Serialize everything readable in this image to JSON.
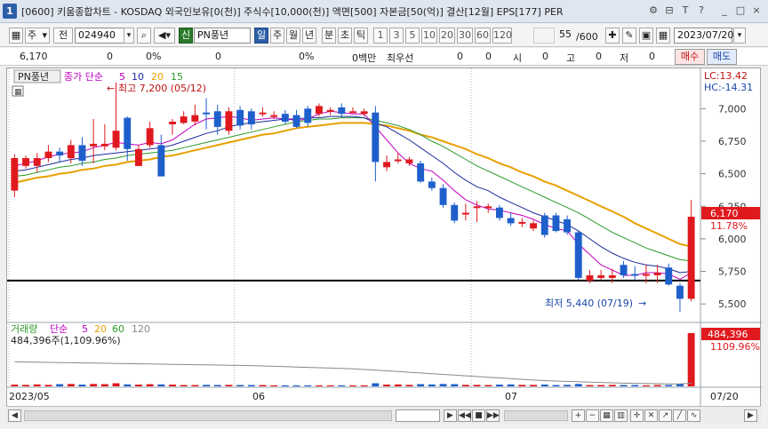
{
  "window": {
    "number": "1",
    "title": "[0600] 키움종합차트 - KOSDAQ 외국인보유[0(천)] 주식수[10,000(천)] 액면[500] 자본금[50(억)] 결산[12월] EPS[177] PER",
    "controls": [
      "⚙",
      "⊟",
      "T",
      "?",
      "_",
      "□",
      "×"
    ]
  },
  "toolbar": {
    "type_label": "주",
    "prev_label": "전",
    "code_value": "024940",
    "signal_label": "신",
    "stock_name": "PN풍년",
    "periods": [
      "일",
      "주",
      "월",
      "년",
      "분",
      "초",
      "틱"
    ],
    "active_period": "일",
    "intervals": [
      "1",
      "3",
      "5",
      "10",
      "20",
      "30",
      "60",
      "120"
    ],
    "count_value": "55",
    "count_total": "/600",
    "date_value": "2023/07/20"
  },
  "inforow": {
    "price": "6,170",
    "change": "0",
    "change_pct": "0%",
    "volume": "0",
    "volume_pct": "0%",
    "amount": "0백만",
    "best_bid_label": "최우선",
    "best_bid": "0",
    "val2": "0",
    "open_label": "시",
    "open": "0",
    "high_label": "고",
    "high": "0",
    "low_label": "저",
    "low": "0",
    "buy_label": "매수",
    "sell_label": "매도"
  },
  "price_panel": {
    "stock_tag": "PN풍년",
    "ma_label": "종가 단순",
    "ma_periods": [
      {
        "label": "5",
        "color": "#c000c0"
      },
      {
        "label": "10",
        "color": "#1a2a9a"
      },
      {
        "label": "20",
        "color": "#e8a000"
      },
      {
        "label": "15",
        "color": "#2a9a2a"
      }
    ],
    "lc_label": "LC:13.42",
    "hc_label": "HC:-14.31",
    "max_note": "최고 7,200 (05/12)",
    "min_note": "최저 5,440 (07/19)",
    "current_price_tag": "6,170",
    "current_pct_tag": "11.78%",
    "y_ticks": [
      "7,000",
      "6,750",
      "6,500",
      "6,250",
      "6,000",
      "5,750",
      "5,500"
    ]
  },
  "volume_panel": {
    "label": "거래량",
    "ma_label": "단순",
    "ma_periods": [
      {
        "label": "5",
        "color": "#c000c0"
      },
      {
        "label": "20",
        "color": "#e8a000"
      },
      {
        "label": "60",
        "color": "#2a9a2a"
      },
      {
        "label": "120",
        "color": "#888888"
      }
    ],
    "current_text": "484,396주(1,109.96%)",
    "tag_value": "484,396",
    "tag_pct": "1109.96%"
  },
  "x_axis": {
    "labels": [
      "2023/05",
      "06",
      "07"
    ],
    "right_label": "07/20"
  },
  "colors": {
    "up": "#e0191e",
    "down": "#1f5fcc",
    "accent": "#2d5fa8"
  },
  "chart_data": {
    "type": "candlestick",
    "ylim": [
      5440,
      7200
    ],
    "horizontal_line": 5680,
    "candles": [
      {
        "o": 6370,
        "c": 6620,
        "h": 6650,
        "l": 6320,
        "up": true
      },
      {
        "o": 6560,
        "c": 6620,
        "h": 6640,
        "l": 6540,
        "up": true
      },
      {
        "o": 6560,
        "c": 6620,
        "h": 6660,
        "l": 6510,
        "up": true
      },
      {
        "o": 6620,
        "c": 6670,
        "h": 6720,
        "l": 6590,
        "up": true
      },
      {
        "o": 6670,
        "c": 6640,
        "h": 6700,
        "l": 6590,
        "up": false
      },
      {
        "o": 6620,
        "c": 6720,
        "h": 6760,
        "l": 6580,
        "up": true
      },
      {
        "o": 6720,
        "c": 6600,
        "h": 6780,
        "l": 6560,
        "up": false
      },
      {
        "o": 6710,
        "c": 6730,
        "h": 6920,
        "l": 6580,
        "up": true
      },
      {
        "o": 6710,
        "c": 6730,
        "h": 6880,
        "l": 6680,
        "up": true
      },
      {
        "o": 6700,
        "c": 6830,
        "h": 7200,
        "l": 6680,
        "up": true
      },
      {
        "o": 6930,
        "c": 6690,
        "h": 6940,
        "l": 6600,
        "up": false
      },
      {
        "o": 6560,
        "c": 6690,
        "h": 6720,
        "l": 6560,
        "up": true
      },
      {
        "o": 6720,
        "c": 6850,
        "h": 6900,
        "l": 6700,
        "up": true
      },
      {
        "o": 6720,
        "c": 6480,
        "h": 6800,
        "l": 6480,
        "up": false
      },
      {
        "o": 6880,
        "c": 6900,
        "h": 6920,
        "l": 6800,
        "up": true
      },
      {
        "o": 6890,
        "c": 6940,
        "h": 6980,
        "l": 6880,
        "up": true
      },
      {
        "o": 6900,
        "c": 6950,
        "h": 7030,
        "l": 6870,
        "up": true
      },
      {
        "o": 6970,
        "c": 6960,
        "h": 7080,
        "l": 6840,
        "up": false
      },
      {
        "o": 6980,
        "c": 6860,
        "h": 7030,
        "l": 6800,
        "up": false
      },
      {
        "o": 6830,
        "c": 6980,
        "h": 7010,
        "l": 6800,
        "up": true
      },
      {
        "o": 6990,
        "c": 6870,
        "h": 7020,
        "l": 6840,
        "up": false
      },
      {
        "o": 6980,
        "c": 6880,
        "h": 7000,
        "l": 6840,
        "up": false
      },
      {
        "o": 6960,
        "c": 6970,
        "h": 7010,
        "l": 6940,
        "up": true
      },
      {
        "o": 6950,
        "c": 6940,
        "h": 6980,
        "l": 6920,
        "up": true
      },
      {
        "o": 6960,
        "c": 6900,
        "h": 6990,
        "l": 6880,
        "up": false
      },
      {
        "o": 6950,
        "c": 6860,
        "h": 6990,
        "l": 6850,
        "up": false
      },
      {
        "o": 7000,
        "c": 6890,
        "h": 7020,
        "l": 6860,
        "up": false
      },
      {
        "o": 6960,
        "c": 7020,
        "h": 7040,
        "l": 6940,
        "up": true
      },
      {
        "o": 6980,
        "c": 6990,
        "h": 7010,
        "l": 6950,
        "up": true
      },
      {
        "o": 7010,
        "c": 6960,
        "h": 7040,
        "l": 6930,
        "up": false
      },
      {
        "o": 6980,
        "c": 6980,
        "h": 7010,
        "l": 6970,
        "up": true
      },
      {
        "o": 6980,
        "c": 6960,
        "h": 7000,
        "l": 6940,
        "up": true
      },
      {
        "o": 6970,
        "c": 6590,
        "h": 7020,
        "l": 6440,
        "up": false
      },
      {
        "o": 6590,
        "c": 6550,
        "h": 6640,
        "l": 6520,
        "up": true
      },
      {
        "o": 6600,
        "c": 6610,
        "h": 6660,
        "l": 6580,
        "up": true
      },
      {
        "o": 6610,
        "c": 6580,
        "h": 6630,
        "l": 6560,
        "up": true
      },
      {
        "o": 6580,
        "c": 6440,
        "h": 6600,
        "l": 6430,
        "up": false
      },
      {
        "o": 6440,
        "c": 6390,
        "h": 6470,
        "l": 6370,
        "up": false
      },
      {
        "o": 6390,
        "c": 6260,
        "h": 6420,
        "l": 6240,
        "up": false
      },
      {
        "o": 6260,
        "c": 6140,
        "h": 6280,
        "l": 6120,
        "up": false
      },
      {
        "o": 6190,
        "c": 6200,
        "h": 6270,
        "l": 6140,
        "up": true
      },
      {
        "o": 6240,
        "c": 6250,
        "h": 6290,
        "l": 6130,
        "up": true
      },
      {
        "o": 6250,
        "c": 6240,
        "h": 6270,
        "l": 6200,
        "up": true
      },
      {
        "o": 6240,
        "c": 6160,
        "h": 6260,
        "l": 6140,
        "up": false
      },
      {
        "o": 6160,
        "c": 6120,
        "h": 6200,
        "l": 6100,
        "up": false
      },
      {
        "o": 6130,
        "c": 6120,
        "h": 6160,
        "l": 6090,
        "up": true
      },
      {
        "o": 6120,
        "c": 6080,
        "h": 6140,
        "l": 6060,
        "up": true
      },
      {
        "o": 6180,
        "c": 6030,
        "h": 6200,
        "l": 6010,
        "up": false
      },
      {
        "o": 6180,
        "c": 6060,
        "h": 6200,
        "l": 6050,
        "up": false
      },
      {
        "o": 6150,
        "c": 6050,
        "h": 6180,
        "l": 6030,
        "up": false
      },
      {
        "o": 6050,
        "c": 5700,
        "h": 6060,
        "l": 5680,
        "up": false
      },
      {
        "o": 5680,
        "c": 5720,
        "h": 5760,
        "l": 5660,
        "up": true
      },
      {
        "o": 5700,
        "c": 5720,
        "h": 5760,
        "l": 5680,
        "up": true
      },
      {
        "o": 5700,
        "c": 5720,
        "h": 5770,
        "l": 5660,
        "up": true
      },
      {
        "o": 5800,
        "c": 5720,
        "h": 5830,
        "l": 5700,
        "up": false
      },
      {
        "o": 5730,
        "c": 5730,
        "h": 5790,
        "l": 5680,
        "up": false
      },
      {
        "o": 5730,
        "c": 5730,
        "h": 5800,
        "l": 5660,
        "up": true
      },
      {
        "o": 5720,
        "c": 5740,
        "h": 5800,
        "l": 5660,
        "up": true
      },
      {
        "o": 5780,
        "c": 5650,
        "h": 5810,
        "l": 5640,
        "up": false
      },
      {
        "o": 5640,
        "c": 5540,
        "h": 5660,
        "l": 5440,
        "up": false
      },
      {
        "o": 5540,
        "c": 6170,
        "h": 6300,
        "l": 5520,
        "up": true
      }
    ],
    "ma5": [
      6560,
      6580,
      6600,
      6630,
      6650,
      6660,
      6670,
      6700,
      6720,
      6740,
      6730,
      6720,
      6740,
      6730,
      6760,
      6820,
      6880,
      6920,
      6930,
      6940,
      6930,
      6910,
      6920,
      6930,
      6920,
      6910,
      6920,
      6960,
      6980,
      6970,
      6960,
      6960,
      6860,
      6760,
      6660,
      6580,
      6540,
      6520,
      6450,
      6370,
      6300,
      6260,
      6230,
      6220,
      6200,
      6180,
      6150,
      6110,
      6080,
      6060,
      5960,
      5880,
      5800,
      5760,
      5720,
      5720,
      5740,
      5740,
      5730,
      5690,
      5740
    ],
    "ma10": [
      6520,
      6530,
      6550,
      6570,
      6590,
      6610,
      6620,
      6640,
      6650,
      6660,
      6670,
      6680,
      6690,
      6700,
      6720,
      6750,
      6780,
      6810,
      6830,
      6860,
      6880,
      6890,
      6900,
      6910,
      6920,
      6920,
      6930,
      6930,
      6940,
      6940,
      6940,
      6930,
      6890,
      6860,
      6810,
      6760,
      6700,
      6640,
      6580,
      6510,
      6450,
      6400,
      6370,
      6320,
      6280,
      6240,
      6200,
      6170,
      6140,
      6110,
      6060,
      6000,
      5940,
      5890,
      5850,
      5820,
      5800,
      5790,
      5770,
      5740,
      5750
    ],
    "ma15": [
      6480,
      6490,
      6510,
      6530,
      6550,
      6560,
      6580,
      6590,
      6610,
      6620,
      6640,
      6650,
      6660,
      6670,
      6680,
      6700,
      6720,
      6740,
      6760,
      6780,
      6800,
      6820,
      6840,
      6860,
      6880,
      6900,
      6910,
      6920,
      6920,
      6930,
      6930,
      6930,
      6910,
      6890,
      6870,
      6840,
      6800,
      6750,
      6710,
      6660,
      6610,
      6560,
      6520,
      6480,
      6440,
      6400,
      6360,
      6320,
      6280,
      6240,
      6200,
      6150,
      6100,
      6050,
      6010,
      5970,
      5930,
      5900,
      5870,
      5840,
      5830
    ],
    "ma20": [
      6430,
      6450,
      6470,
      6480,
      6500,
      6510,
      6530,
      6540,
      6560,
      6570,
      6590,
      6600,
      6610,
      6630,
      6640,
      6660,
      6680,
      6700,
      6720,
      6740,
      6760,
      6780,
      6800,
      6810,
      6830,
      6850,
      6860,
      6870,
      6880,
      6890,
      6890,
      6890,
      6880,
      6870,
      6850,
      6830,
      6800,
      6780,
      6750,
      6720,
      6690,
      6650,
      6620,
      6580,
      6550,
      6510,
      6480,
      6440,
      6410,
      6370,
      6330,
      6290,
      6250,
      6210,
      6170,
      6120,
      6080,
      6040,
      6000,
      5960,
      5940
    ],
    "volume": [
      16,
      14,
      18,
      14,
      20,
      22,
      16,
      22,
      20,
      28,
      18,
      16,
      20,
      18,
      16,
      12,
      12,
      14,
      12,
      14,
      12,
      12,
      12,
      10,
      10,
      10,
      10,
      10,
      10,
      10,
      10,
      10,
      28,
      16,
      18,
      14,
      20,
      18,
      22,
      20,
      14,
      14,
      12,
      16,
      18,
      14,
      14,
      16,
      12,
      14,
      22,
      12,
      12,
      14,
      12,
      12,
      10,
      12,
      12,
      20,
      484
    ],
    "volume_up": [
      true,
      true,
      true,
      true,
      false,
      true,
      false,
      true,
      true,
      true,
      false,
      true,
      true,
      false,
      true,
      true,
      true,
      false,
      false,
      true,
      false,
      false,
      true,
      true,
      false,
      false,
      false,
      true,
      true,
      false,
      true,
      true,
      false,
      true,
      true,
      true,
      false,
      false,
      false,
      false,
      true,
      true,
      true,
      false,
      false,
      true,
      true,
      false,
      false,
      false,
      false,
      true,
      true,
      true,
      false,
      false,
      true,
      true,
      false,
      false,
      true
    ],
    "vol_ma_upper": [
      140,
      138,
      137,
      136,
      135,
      134,
      133,
      132,
      131,
      130,
      129,
      128,
      127,
      126,
      125,
      124,
      123,
      122,
      121,
      120,
      119,
      118,
      116,
      114,
      112,
      110,
      108,
      106,
      104,
      102,
      100,
      96,
      92,
      88,
      84,
      80,
      76,
      72,
      68,
      64,
      60,
      56,
      52,
      48,
      44,
      40,
      36,
      33,
      30,
      28,
      26,
      24,
      22,
      20,
      18,
      17,
      16,
      15,
      14,
      14,
      18
    ]
  }
}
